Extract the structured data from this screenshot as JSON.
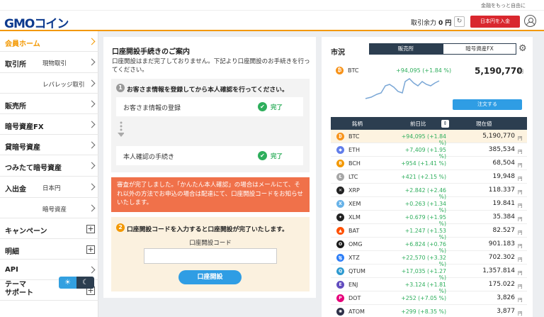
{
  "header": {
    "tagline": "金融をもっと自由に",
    "logo": "GMOコイン",
    "balance_label": "取引余力",
    "balance_value": "0 円",
    "deposit_button": "日本円を入金"
  },
  "sidebar": {
    "items": [
      {
        "label": "会員ホーム",
        "active": true
      },
      {
        "label": "取引所",
        "sub": "現物取引"
      },
      {
        "label": "",
        "sub": "レバレッジ取引"
      },
      {
        "label": "販売所"
      },
      {
        "label": "暗号資産FX"
      },
      {
        "label": "貸暗号資産"
      },
      {
        "label": "つみたて暗号資産"
      },
      {
        "label": "入出金",
        "sub": "日本円"
      },
      {
        "label": "",
        "sub": "暗号資産"
      },
      {
        "label": "キャンペーン",
        "expand": "+"
      },
      {
        "label": "明細",
        "expand": "+"
      },
      {
        "label": "API"
      },
      {
        "label": "サポート",
        "expand": "+"
      }
    ],
    "theme_label": "テーマ",
    "accent_color": "#f39800"
  },
  "account_guide": {
    "title": "口座開設手続きのご案内",
    "description": "口座開設はまだ完了しておりません。下記より口座開設のお手続きを行ってください。",
    "step1": {
      "number": "1",
      "title": "お客さま情報を登録してから本人確認を行ってください。",
      "rows": [
        {
          "label": "お客さま情報の登録",
          "status": "完了"
        },
        {
          "label": "本人確認の手続き",
          "status": "完了"
        }
      ]
    },
    "notice": "審査が完了しました。「かんたん本人確認」の場合はメールにて、それ以外の方法でお申込の場合は配達にて、口座開設コードをお知らせいたします。",
    "step2": {
      "number": "2",
      "title": "口座開設コードを入力すると口座開設が完了いたします。",
      "code_label": "口座開設コード",
      "code_value": "",
      "button": "口座開設"
    }
  },
  "market": {
    "title": "市況",
    "tabs": [
      "販売所",
      "暗号資産FX"
    ],
    "featured": {
      "symbol": "BTC",
      "change": "+94,095 (+1.84 %)",
      "price": "5,190,770",
      "unit": "円",
      "order_button": "注文する"
    },
    "columns": [
      "銘柄",
      "前日比",
      "現在値"
    ],
    "rows": [
      {
        "symbol": "BTC",
        "change": "+94,095 (+1.84 %)",
        "price": "5,190,770",
        "unit": "円",
        "color": "#f7931a",
        "glyph": "₿"
      },
      {
        "symbol": "ETH",
        "change": "+7,409 (+1.95 %)",
        "price": "385,534",
        "unit": "円",
        "color": "#627eea",
        "glyph": "◆"
      },
      {
        "symbol": "BCH",
        "change": "+954 (+1.41 %)",
        "price": "68,504",
        "unit": "円",
        "color": "#f39800",
        "glyph": "B"
      },
      {
        "symbol": "LTC",
        "change": "+421 (+2.15 %)",
        "price": "19,948",
        "unit": "円",
        "color": "#a6a6a6",
        "glyph": "Ł"
      },
      {
        "symbol": "XRP",
        "change": "+2.842 (+2.46 %)",
        "price": "118.337",
        "unit": "円",
        "color": "#222222",
        "glyph": "✕"
      },
      {
        "symbol": "XEM",
        "change": "+0.263 (+1.34 %)",
        "price": "19.841",
        "unit": "円",
        "color": "#67b2e8",
        "glyph": "X"
      },
      {
        "symbol": "XLM",
        "change": "+0.679 (+1.95 %)",
        "price": "35.384",
        "unit": "円",
        "color": "#222222",
        "glyph": "✦"
      },
      {
        "symbol": "BAT",
        "change": "+1.247 (+1.53 %)",
        "price": "82.527",
        "unit": "円",
        "color": "#ff5000",
        "glyph": "▲"
      },
      {
        "symbol": "OMG",
        "change": "+6.824 (+0.76 %)",
        "price": "901.183",
        "unit": "円",
        "color": "#1a1a1a",
        "glyph": "O"
      },
      {
        "symbol": "XTZ",
        "change": "+22,570 (+3.32 %)",
        "price": "702.302",
        "unit": "円",
        "color": "#2c7df7",
        "glyph": "ꜩ"
      },
      {
        "symbol": "QTUM",
        "change": "+17,035 (+1.27 %)",
        "price": "1,357.814",
        "unit": "円",
        "color": "#2e9ad0",
        "glyph": "Q"
      },
      {
        "symbol": "ENJ",
        "change": "+3.124 (+1.81 %)",
        "price": "175.022",
        "unit": "円",
        "color": "#624dbf",
        "glyph": "E"
      },
      {
        "symbol": "DOT",
        "change": "+252 (+7.05 %)",
        "price": "3,826",
        "unit": "円",
        "color": "#e6007a",
        "glyph": "P"
      },
      {
        "symbol": "ATOM",
        "change": "+299 (+8.35 %)",
        "price": "3,877",
        "unit": "円",
        "color": "#2e3148",
        "glyph": "✺"
      }
    ],
    "positive_color": "#2eae5c"
  }
}
